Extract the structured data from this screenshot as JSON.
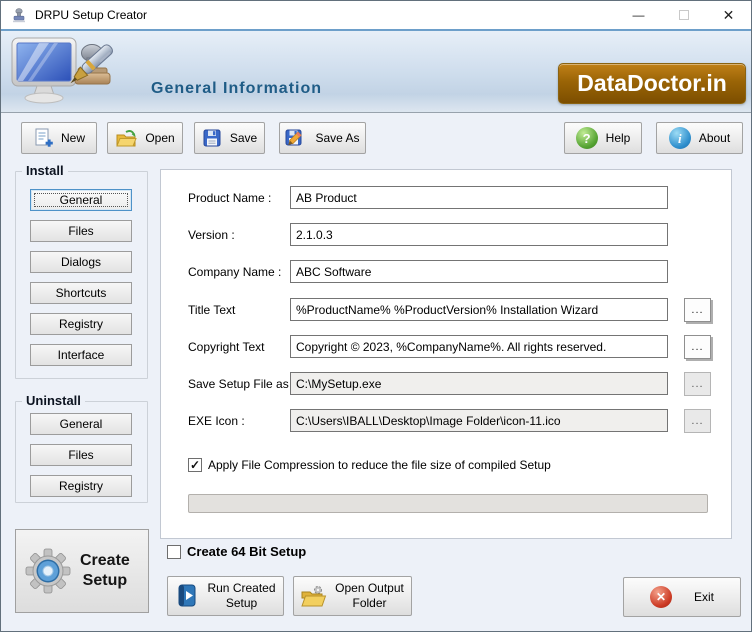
{
  "window": {
    "title": "DRPU Setup Creator",
    "minimize_glyph": "—",
    "close_glyph": "✕"
  },
  "header": {
    "title": "General Information",
    "logo": "DataDoctor.in"
  },
  "toolbar": {
    "new": "New",
    "open": "Open",
    "save": "Save",
    "save_as": "Save As",
    "help": "Help",
    "about": "About"
  },
  "icons": {
    "help_glyph": "?",
    "about_glyph": "i",
    "exit_glyph": "✕",
    "check_glyph": "✓"
  },
  "colors": {
    "header_text": "#1f5c86",
    "logo_orange": "#9a6406",
    "accent_blue": "#2a6ea6"
  },
  "sidebar": {
    "install": {
      "title": "Install",
      "items": [
        {
          "label": "General",
          "active": true
        },
        {
          "label": "Files"
        },
        {
          "label": "Dialogs"
        },
        {
          "label": "Shortcuts"
        },
        {
          "label": "Registry"
        },
        {
          "label": "Interface"
        }
      ]
    },
    "uninstall": {
      "title": "Uninstall",
      "items": [
        {
          "label": "General"
        },
        {
          "label": "Files"
        },
        {
          "label": "Registry"
        }
      ]
    },
    "create_setup": {
      "line1": "Create",
      "line2": "Setup"
    }
  },
  "form": {
    "browse_label": "...",
    "fields": [
      {
        "label": "Product Name :",
        "value": "AB Product"
      },
      {
        "label": "Version :",
        "value": "2.1.0.3"
      },
      {
        "label": "Company Name :",
        "value": "ABC Software"
      },
      {
        "label": "Title Text",
        "value": "%ProductName% %ProductVersion% Installation Wizard"
      },
      {
        "label": "Copyright Text",
        "value": "Copyright © 2023, %CompanyName%. All rights reserved."
      },
      {
        "label": "Save Setup File as :",
        "value": "C:\\MySetup.exe"
      },
      {
        "label": "EXE Icon :",
        "value": "C:\\Users\\IBALL\\Desktop\\Image Folder\\icon-11.ico"
      }
    ],
    "compression": {
      "label": "Apply File Compression to reduce the file size of compiled Setup",
      "checked": true
    },
    "progress_value": 0
  },
  "footer": {
    "bit64": {
      "label": "Create 64 Bit Setup",
      "checked": false
    },
    "run": {
      "line1": "Run Created",
      "line2": "Setup"
    },
    "output": {
      "line1": "Open Output",
      "line2": "Folder"
    },
    "exit": {
      "label": "Exit"
    }
  }
}
